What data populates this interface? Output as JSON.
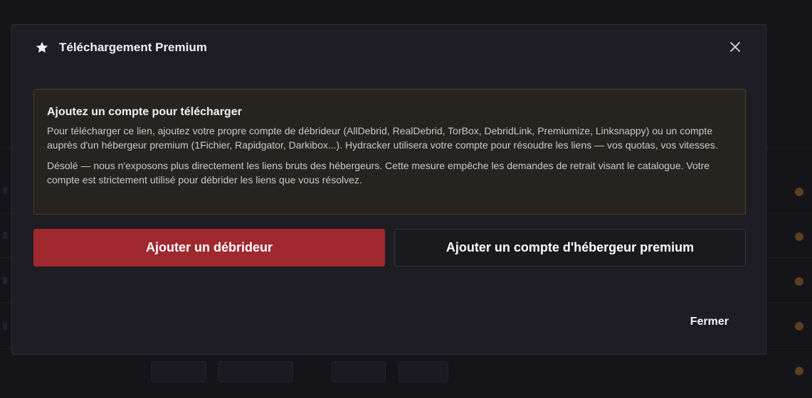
{
  "modal": {
    "title": "Téléchargement Premium",
    "title_icon": "star-icon",
    "close_icon": "close-icon"
  },
  "notice": {
    "heading": "Ajoutez un compte pour télécharger",
    "paragraph_1": "Pour télécharger ce lien, ajoutez votre propre compte de débrideur (AllDebrid, RealDebrid, TorBox, DebridLink, Premiumize, Linksnappy) ou un compte auprès d'un hébergeur premium (1Fichier, Rapidgator, Darkibox...). Hydracker utilisera votre compte pour résoudre les liens — vos quotas, vos vitesses.",
    "paragraph_2": "Désolé — nous n'exposons plus directement les liens bruts des hébergeurs. Cette mesure empêche les demandes de retrait visant le catalogue. Votre compte est strictement utilisé pour débrider les liens que vous résolvez."
  },
  "actions": {
    "add_debrider_label": "Ajouter un débrideur",
    "add_premium_host_label": "Ajouter un compte d'hébergeur premium",
    "close_label": "Fermer"
  },
  "colors": {
    "primary_button": "#a0282f",
    "notice_border": "#4e3f2c",
    "modal_background": "#1e1d23"
  }
}
